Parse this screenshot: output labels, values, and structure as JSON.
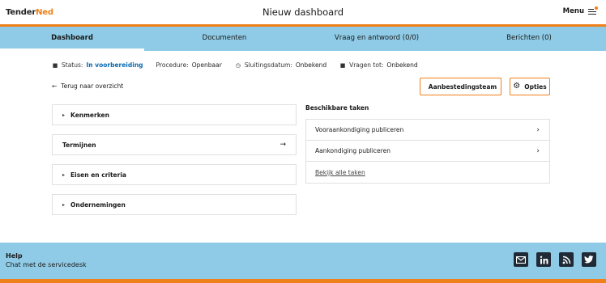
{
  "header": {
    "logo_part1": "Tender",
    "logo_part2": "Ned",
    "title": "Nieuw dashboard",
    "menu_label": "Menu"
  },
  "tabs": [
    {
      "label": "Dashboard",
      "active": true
    },
    {
      "label": "Documenten",
      "active": false
    },
    {
      "label": "Vraag en antwoord (0/0)",
      "active": false
    },
    {
      "label": "Berichten (0)",
      "active": false
    }
  ],
  "status": {
    "status_label": "Status:",
    "status_value": "In voorbereiding",
    "procedure_label": "Procedure:",
    "procedure_value": "Openbaar",
    "closing_label": "Sluitingsdatum:",
    "closing_value": "Onbekend",
    "questions_label": "Vragen tot:",
    "questions_value": "Onbekend"
  },
  "back_link": "Terug naar overzicht",
  "buttons": {
    "team": "Aanbestedingsteam",
    "options": "Opties"
  },
  "accordions": [
    {
      "label": "Kenmerken"
    },
    {
      "label": "Termijnen"
    },
    {
      "label": "Eisen en criteria"
    },
    {
      "label": "Ondernemingen"
    }
  ],
  "tasks": {
    "title": "Beschikbare taken",
    "items": [
      {
        "label": "Vooraankondiging publiceren"
      },
      {
        "label": "Aankondiging publiceren"
      }
    ],
    "all_link": "Bekijk alle taken"
  },
  "footer": {
    "help_title": "Help",
    "help_link": "Chat met de servicedesk"
  },
  "colors": {
    "accent": "#f08019",
    "nav_bg": "#8fcbe6",
    "link_blue": "#0a6bb3"
  }
}
